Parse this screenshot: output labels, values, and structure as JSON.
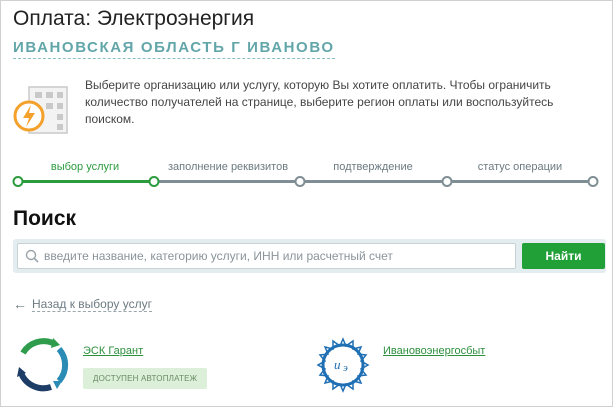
{
  "page": {
    "title": "Оплата: Электроэнергия",
    "region": "ИВАНОВСКАЯ ОБЛАСТЬ Г ИВАНОВО"
  },
  "info": {
    "icon": "lightning-building-icon",
    "text": "Выберите организацию или услугу, которую Вы хотите оплатить. Чтобы ограничить количество получателей на странице, выберите регион оплаты или воспользуйтесь поиском."
  },
  "steps": [
    {
      "label": "выбор услуги",
      "active": true
    },
    {
      "label": "заполнение реквизитов",
      "active": false
    },
    {
      "label": "подтверждение",
      "active": false
    },
    {
      "label": "статус операции",
      "active": false
    }
  ],
  "search": {
    "title": "Поиск",
    "placeholder": "введите название, категорию услуги, ИНН или расчетный счет",
    "button_label": "Найти"
  },
  "back_link": "Назад к выбору услуг",
  "providers": [
    {
      "name": "ЭСК Гарант",
      "badge": "ДОСТУПЕН АВТОПЛАТЕЖ",
      "logo": "esk-garant-logo"
    },
    {
      "name": "Ивановоэнергосбыт",
      "badge": "",
      "logo": "ivanovoenergosbyt-logo"
    }
  ],
  "colors": {
    "accent_green": "#21a038",
    "region_teal": "#63a6a9",
    "step_inactive": "#7f8e95"
  }
}
